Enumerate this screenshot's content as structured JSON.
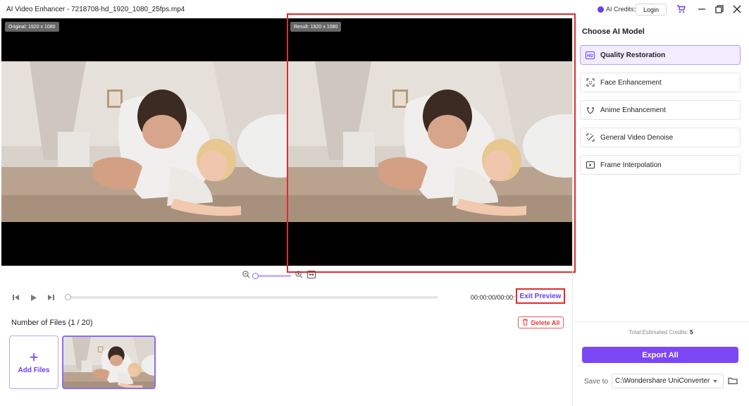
{
  "window": {
    "title": "AI Video Enhancer - 7218708-hd_1920_1080_25fps.mp4",
    "credits_label": "AI Credits:",
    "login_label": "Login"
  },
  "preview": {
    "original_label": "Original: 1920 x 1080",
    "result_label": "Result: 1920 x 1080"
  },
  "playback": {
    "timecode": "00:00:00/00:00:00",
    "exit_preview_label": "Exit Preview"
  },
  "files": {
    "count_label": "Number of Files (1 / 20)",
    "delete_all_label": "Delete All",
    "add_files_label": "Add Files"
  },
  "panel": {
    "title": "Choose AI Model",
    "models": [
      {
        "label": "Quality Restoration",
        "icon": "hd-icon",
        "active": true
      },
      {
        "label": "Face Enhancement",
        "icon": "face-scan-icon",
        "active": false
      },
      {
        "label": "Anime Enhancement",
        "icon": "anime-icon",
        "active": false
      },
      {
        "label": "General Video Denoise",
        "icon": "denoise-icon",
        "active": false
      },
      {
        "label": "Frame Interpolation",
        "icon": "frame-interpolation-icon",
        "active": false
      }
    ],
    "estimated_label": "Total Estimated Credits:",
    "estimated_value": "5",
    "export_label": "Export All",
    "save_to_label": "Save to",
    "save_path": "C:\\Wondershare UniConverter"
  },
  "colors": {
    "accent": "#7c47f5",
    "highlight_red": "#e02b2b",
    "delete_red": "#e33b3b"
  }
}
